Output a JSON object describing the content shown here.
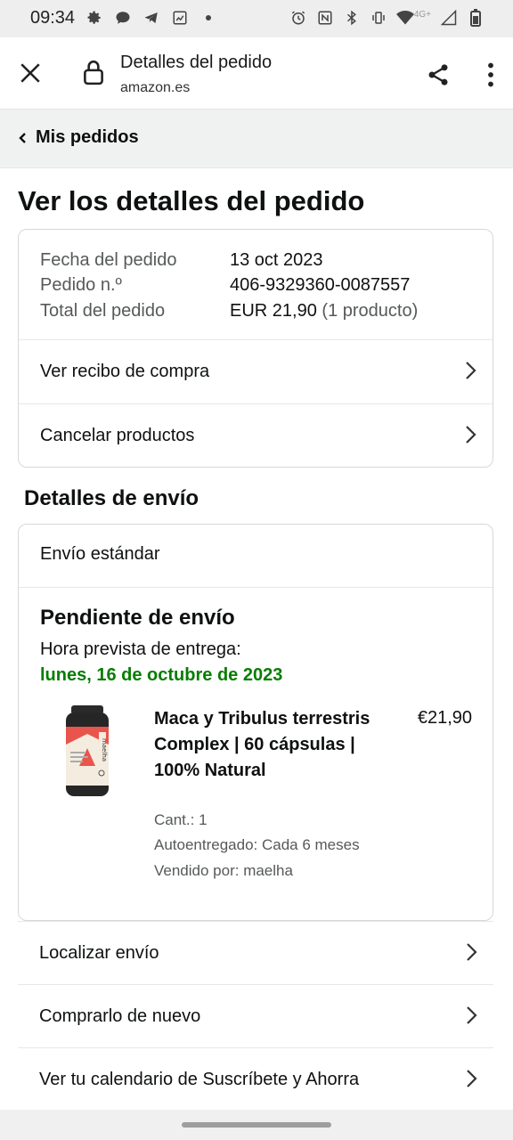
{
  "status_bar": {
    "time": "09:34",
    "network": "4G+"
  },
  "toolbar": {
    "title": "Detalles del pedido",
    "url": "amazon.es"
  },
  "breadcrumb": {
    "label": "Mis pedidos"
  },
  "page": {
    "title": "Ver los detalles del pedido"
  },
  "order_summary": {
    "date_label": "Fecha del pedido",
    "date_value": "13 oct 2023",
    "number_label": "Pedido n.º",
    "number_value": "406-9329360-0087557",
    "total_label": "Total del pedido",
    "total_value": "EUR 21,90",
    "total_count": "(1 producto)",
    "links": [
      {
        "label": "Ver recibo de compra"
      },
      {
        "label": "Cancelar productos"
      }
    ]
  },
  "shipping": {
    "section_title": "Detalles de envío",
    "type": "Envío estándar",
    "status": "Pendiente de envío",
    "eta_label": "Hora prevista de entrega:",
    "eta_date": "lunes, 16 de octubre de 2023",
    "product": {
      "name": "Maca y Tribulus terrestris Complex | 60 cápsulas | 100% Natural",
      "price": "€21,90",
      "quantity": "Cant.: 1",
      "subscription": "Autoentregado: Cada 6 meses",
      "seller": "Vendido por: maelha",
      "brand_on_bottle": "maelha"
    }
  },
  "actions": [
    {
      "label": "Localizar envío"
    },
    {
      "label": "Comprarlo de nuevo"
    },
    {
      "label": "Ver tu calendario de Suscríbete y Ahorra"
    }
  ],
  "colors": {
    "eta_green": "#067d00",
    "muted_text": "#565959",
    "crumb_bg": "#f0f2f2"
  }
}
